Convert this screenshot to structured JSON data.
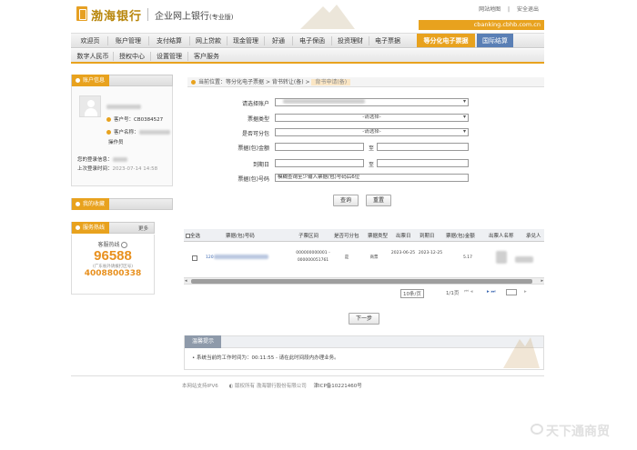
{
  "header": {
    "bank_name": "渤海银行",
    "system_title": "企业网上银行",
    "system_sub": "(专业版)",
    "top_links": [
      "网站地图",
      "安全退出"
    ],
    "url": "cbanking.cbhb.com.cn"
  },
  "nav_row1": [
    {
      "label": "欢迎页"
    },
    {
      "label": "账户管理"
    },
    {
      "label": "支付结算"
    },
    {
      "label": "网上贷款"
    },
    {
      "label": "现金管理"
    },
    {
      "label": "好通"
    },
    {
      "label": "电子保函"
    },
    {
      "label": "投资理财"
    },
    {
      "label": "电子票据"
    },
    {
      "label": "等分化电子票据"
    },
    {
      "label": "国际结算"
    }
  ],
  "nav_row2": [
    {
      "label": "数字人民币"
    },
    {
      "label": "授权中心"
    },
    {
      "label": "设置管理"
    },
    {
      "label": "客户服务"
    }
  ],
  "sidebar": {
    "account_panel_title": "账户信息",
    "customer_no_label": "客户号：",
    "customer_no": "CB0384527",
    "customer_name_label": "客户名称：",
    "role": "操作员",
    "login_info": "您的登录信息：",
    "last_login_label": "上次登录时间：",
    "last_login": "2023-07-14 14:58",
    "favorites_title": "我的收藏",
    "hotline_title": "服务热线",
    "more_label": "更多",
    "hotline_sub": "客服热线",
    "hotline_big": "96588",
    "hotline_note": "(广东省外请拨打区号)",
    "hotline_alt": "4008800338"
  },
  "breadcrumb": {
    "prefix": "当前位置：",
    "path": [
      "等分化电子票据",
      "背书转让(备)"
    ],
    "current": "背书申请(备)"
  },
  "form": {
    "fields": [
      {
        "label": "请选择账户",
        "type": "select",
        "value": ""
      },
      {
        "label": "票据类型",
        "type": "select",
        "value": "-请选择-"
      },
      {
        "label": "是否可分包",
        "type": "select",
        "value": "-请选择-"
      },
      {
        "label": "票据(包)金额",
        "type": "range",
        "sep": "至"
      },
      {
        "label": "到期日",
        "type": "range",
        "sep": "至"
      },
      {
        "label": "票据(包)号码",
        "type": "input",
        "placeholder": "模糊查询至少输入票据(包)号码后6位"
      }
    ],
    "query_btn": "查询",
    "reset_btn": "重置"
  },
  "table": {
    "headers": [
      "全选",
      "票据(包)号码",
      "子票区间",
      "是否可分包",
      "票据类型",
      "出票日",
      "到期日",
      "票据(包)金额",
      "出票人名称",
      "承兑人"
    ],
    "rows": [
      {
        "bill_no": "120",
        "range_a": "000000000001 -",
        "range_b": "000000051761",
        "splittable": "是",
        "type": "商票",
        "issue_date": "2023-06-25",
        "due_date": "2023-12-25",
        "amount": "5.17"
      }
    ]
  },
  "pager": {
    "page_size": "10条/页",
    "page_info": "1/1页"
  },
  "next_btn": "下一步",
  "notice": {
    "title": "温馨提示",
    "text": "系统当前的工作时间为：00:11:55 - 请在此时间段内办理业务。"
  },
  "footer": {
    "left": "本网站支持IPV6",
    "middle": "版权所有 渤海银行股份有限公司",
    "icp": "津ICP备10221460号"
  },
  "watermark": "天下通商贸",
  "colors": {
    "accent": "#e8a21e",
    "intl": "#5a7fb5"
  }
}
